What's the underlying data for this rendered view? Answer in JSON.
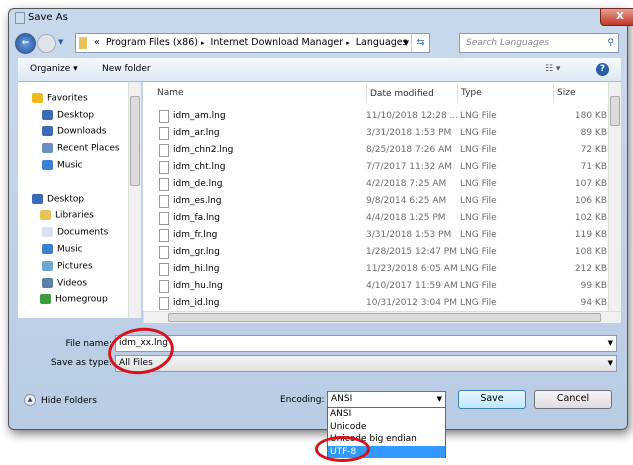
{
  "window": {
    "title": "Save As",
    "close": "X"
  },
  "address": {
    "breadcrumb": [
      "«",
      "Program Files (x86)",
      "▸",
      "Internet Download Manager",
      "▸",
      "Languages"
    ],
    "search_placeholder": "Search Languages"
  },
  "toolbar": {
    "organize": "Organize ▾",
    "new_folder": "New folder",
    "views": "☷ ▾",
    "help": "?"
  },
  "nav": {
    "items": [
      {
        "label": "Favorites",
        "icon": "star-icon"
      },
      {
        "label": "Desktop",
        "icon": "desktop-icon"
      },
      {
        "label": "Downloads",
        "icon": "downloads-icon"
      },
      {
        "label": "Recent Places",
        "icon": "recent-icon"
      },
      {
        "label": "Music",
        "icon": "music-icon"
      },
      {
        "label": "Desktop",
        "icon": "desktop-icon"
      },
      {
        "label": "Libraries",
        "icon": "libraries-icon"
      },
      {
        "label": "Documents",
        "icon": "documents-icon"
      },
      {
        "label": "Music",
        "icon": "music-icon"
      },
      {
        "label": "Pictures",
        "icon": "pictures-icon"
      },
      {
        "label": "Videos",
        "icon": "videos-icon"
      },
      {
        "label": "Homegroup",
        "icon": "homegroup-icon"
      }
    ]
  },
  "columns": [
    "Name",
    "Date modified",
    "Type",
    "Size"
  ],
  "files": [
    [
      "idm_am.lng",
      "11/10/2018 12:28 ...",
      "LNG File",
      "180 KB"
    ],
    [
      "idm_ar.lng",
      "3/31/2018 1:53 PM",
      "LNG File",
      "89 KB"
    ],
    [
      "idm_chn2.lng",
      "8/25/2018 7:26 AM",
      "LNG File",
      "72 KB"
    ],
    [
      "idm_cht.lng",
      "7/7/2017 11:32 AM",
      "LNG File",
      "71 KB"
    ],
    [
      "idm_de.lng",
      "4/2/2018 7:25 AM",
      "LNG File",
      "107 KB"
    ],
    [
      "idm_es.lng",
      "9/8/2014 6:25 AM",
      "LNG File",
      "106 KB"
    ],
    [
      "idm_fa.lng",
      "4/4/2018 1:25 PM",
      "LNG File",
      "102 KB"
    ],
    [
      "idm_fr.lng",
      "3/31/2018 1:53 PM",
      "LNG File",
      "119 KB"
    ],
    [
      "idm_gr.lng",
      "1/28/2015 12:47 PM",
      "LNG File",
      "108 KB"
    ],
    [
      "idm_hi.lng",
      "11/23/2018 6:05 AM",
      "LNG File",
      "212 KB"
    ],
    [
      "idm_hu.lng",
      "4/10/2017 11:59 AM",
      "LNG File",
      "99 KB"
    ],
    [
      "idm_id.lng",
      "10/31/2012 3:04 PM",
      "LNG File",
      "94 KB"
    ]
  ],
  "form": {
    "file_name_label": "File name:",
    "file_name": "idm_xx.lng",
    "save_type_label": "Save as type:",
    "save_type": "All Files"
  },
  "bottom": {
    "hide_folders": "Hide Folders",
    "encoding_label": "Encoding:",
    "encoding": "ANSI",
    "save": "Save",
    "cancel": "Cancel"
  },
  "encoding_options": [
    "ANSI",
    "Unicode",
    "Unicode big endian",
    "UTF-8"
  ],
  "encoding_highlighted": "UTF-8",
  "colors": {
    "highlight": "#3399ff",
    "annotation": "#d8121b"
  }
}
